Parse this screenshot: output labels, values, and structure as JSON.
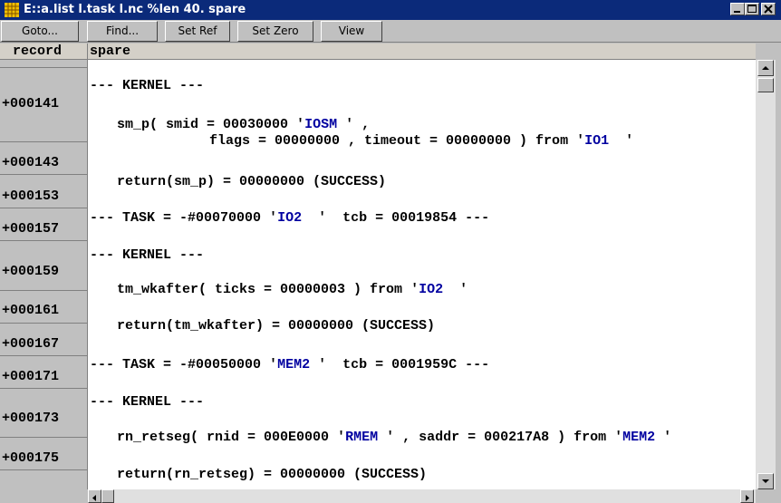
{
  "window": {
    "title": "E::a.list l.task l.nc %len 40. spare",
    "app_icon": "grid-app-icon",
    "controls": [
      "minimize-icon",
      "maximize-icon",
      "close-icon"
    ]
  },
  "toolbar": {
    "goto": "Goto...",
    "find": "Find...",
    "set_ref": "Set Ref",
    "set_zero": "Set Zero",
    "view": "View"
  },
  "columns": {
    "record": "record",
    "spare": "spare"
  },
  "offsets": [
    "+000141",
    "+000143",
    "+000153",
    "+000157",
    "+000159",
    "+000161",
    "+000167",
    "+000171",
    "+000173",
    "+000175"
  ],
  "lines": [
    {
      "parts": [
        {
          "t": "--- KERNEL ---"
        }
      ]
    },
    {
      "parts": [
        {
          "t": "sm_p( smid = 00030000 "
        },
        {
          "t": "'",
          "s": 0
        },
        {
          "t": "IOSM",
          "s": 1
        },
        {
          "t": " '",
          "s": 0
        },
        {
          "t": " ,"
        }
      ]
    },
    {
      "parts": [
        {
          "t": "flags = 00000000 , timeout = 00000000 ) from "
        },
        {
          "t": "'",
          "s": 0
        },
        {
          "t": "IO1",
          "s": 1
        },
        {
          "t": "  '",
          "s": 0
        }
      ]
    },
    {
      "parts": [
        {
          "t": "return(sm_p) = 00000000 (SUCCESS)"
        }
      ]
    },
    {
      "parts": [
        {
          "t": "--- TASK = -#00070000 "
        },
        {
          "t": "'",
          "s": 0
        },
        {
          "t": "IO2",
          "s": 1
        },
        {
          "t": "  '",
          "s": 0
        },
        {
          "t": "  tcb = 00019854 ---"
        }
      ]
    },
    {
      "parts": [
        {
          "t": "--- KERNEL ---"
        }
      ]
    },
    {
      "parts": [
        {
          "t": "tm_wkafter( ticks = 00000003 ) from "
        },
        {
          "t": "'",
          "s": 0
        },
        {
          "t": "IO2",
          "s": 1
        },
        {
          "t": "  '",
          "s": 0
        }
      ]
    },
    {
      "parts": [
        {
          "t": "return(tm_wkafter) = 00000000 (SUCCESS)"
        }
      ]
    },
    {
      "parts": [
        {
          "t": "--- TASK = -#00050000 "
        },
        {
          "t": "'",
          "s": 0
        },
        {
          "t": "MEM2",
          "s": 1
        },
        {
          "t": " '",
          "s": 0
        },
        {
          "t": "  tcb = 0001959C ---"
        }
      ]
    },
    {
      "parts": [
        {
          "t": "--- KERNEL ---"
        }
      ]
    },
    {
      "parts": [
        {
          "t": "rn_retseg( rnid = 000E0000 "
        },
        {
          "t": "'",
          "s": 0
        },
        {
          "t": "RMEM",
          "s": 1
        },
        {
          "t": " '",
          "s": 0
        },
        {
          "t": " , saddr = 000217A8 ) from "
        },
        {
          "t": "'",
          "s": 0
        },
        {
          "t": "MEM2",
          "s": 1
        },
        {
          "t": " '",
          "s": 0
        }
      ]
    },
    {
      "parts": [
        {
          "t": "return(rn_retseg) = 00000000 (SUCCESS)"
        }
      ]
    }
  ],
  "colors": {
    "title_bar": "#0b2a7a",
    "string_literal": "#0000a0",
    "chrome": "#c0c0c0"
  }
}
